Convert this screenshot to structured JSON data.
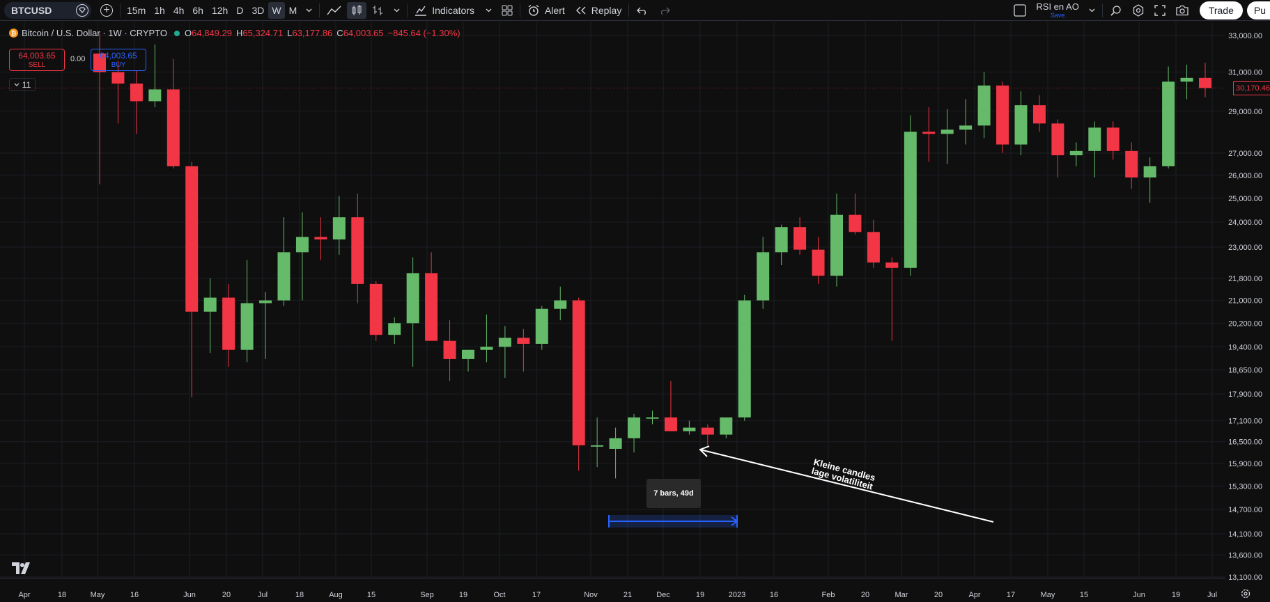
{
  "toolbar": {
    "symbol": "BTCUSD",
    "intervals": [
      "15m",
      "1h",
      "4h",
      "6h",
      "12h",
      "D",
      "3D",
      "W",
      "M"
    ],
    "active_interval": "W",
    "indicators_label": "Indicators",
    "alert_label": "Alert",
    "replay_label": "Replay",
    "layout_name": "RSI en AO",
    "layout_save": "Save",
    "trade_label": "Trade",
    "publish_label": "Pu"
  },
  "legend": {
    "title": "Bitcoin / U.S. Dollar · 1W · CRYPTO",
    "coin_glyph": "₿",
    "o_label": "O",
    "o_value": "64,849.29",
    "h_label": "H",
    "h_value": "65,324.71",
    "l_label": "L",
    "l_value": "63,177.86",
    "c_label": "C",
    "c_value": "64,003.65",
    "change": "−845.64 (−1.30%)"
  },
  "orders": {
    "sell_price": "64,003.65",
    "sell_label": "SELL",
    "spread": "0.00",
    "buy_price": "64,003.65",
    "buy_label": "BUY",
    "collapse_count": "11"
  },
  "last_price_badge": "30,170.46",
  "range_tooltip": "7 bars, 49d",
  "annotation": {
    "line1": "Kleine candles",
    "line2": "lage volatiliteit"
  },
  "colors": {
    "up": "#66bb6a",
    "down": "#f23645",
    "background": "#0f0f0f",
    "grid": "#1c1f26",
    "range": "#2962ff"
  },
  "chart_data": {
    "type": "candlestick",
    "y_axis_labels": [
      "33,000.00",
      "31,000.00",
      "29,000.00",
      "27,000.00",
      "26,000.00",
      "25,000.00",
      "24,000.00",
      "23,000.00",
      "21,800.00",
      "21,000.00",
      "20,200.00",
      "19,400.00",
      "18,650.00",
      "17,900.00",
      "17,100.00",
      "16,500.00",
      "15,900.00",
      "15,300.00",
      "14,700.00",
      "14,100.00",
      "13,600.00",
      "13,100.00"
    ],
    "x_axis_labels": [
      "Apr",
      "18",
      "May",
      "16",
      "Jun",
      "20",
      "Jul",
      "18",
      "Aug",
      "15",
      "Sep",
      "19",
      "Oct",
      "17",
      "Nov",
      "21",
      "Dec",
      "19",
      "2023",
      "16",
      "Feb",
      "20",
      "Mar",
      "20",
      "Apr",
      "17",
      "May",
      "15",
      "Jun",
      "19",
      "Jul"
    ],
    "candles": [
      {
        "o": 32000,
        "h": 33200,
        "l": 25600,
        "c": 31000
      },
      {
        "o": 31000,
        "h": 31600,
        "l": 28400,
        "c": 30400
      },
      {
        "o": 30400,
        "h": 31100,
        "l": 27900,
        "c": 29500
      },
      {
        "o": 29500,
        "h": 32500,
        "l": 29200,
        "c": 30100
      },
      {
        "o": 30100,
        "h": 31700,
        "l": 26300,
        "c": 26400
      },
      {
        "o": 26400,
        "h": 26600,
        "l": 17800,
        "c": 20600
      },
      {
        "o": 20600,
        "h": 21800,
        "l": 19200,
        "c": 21100
      },
      {
        "o": 21100,
        "h": 21600,
        "l": 18750,
        "c": 19300
      },
      {
        "o": 19300,
        "h": 22500,
        "l": 18900,
        "c": 20900
      },
      {
        "o": 20900,
        "h": 21300,
        "l": 19000,
        "c": 21000
      },
      {
        "o": 21000,
        "h": 24200,
        "l": 20800,
        "c": 22800
      },
      {
        "o": 22800,
        "h": 24400,
        "l": 21000,
        "c": 23400
      },
      {
        "o": 23400,
        "h": 24200,
        "l": 22500,
        "c": 23300
      },
      {
        "o": 23300,
        "h": 25100,
        "l": 22700,
        "c": 24200
      },
      {
        "o": 24200,
        "h": 25200,
        "l": 20900,
        "c": 21600
      },
      {
        "o": 21600,
        "h": 21700,
        "l": 19600,
        "c": 19800
      },
      {
        "o": 19800,
        "h": 20400,
        "l": 19500,
        "c": 20200
      },
      {
        "o": 20200,
        "h": 22600,
        "l": 18750,
        "c": 22000
      },
      {
        "o": 22000,
        "h": 22800,
        "l": 19700,
        "c": 19600
      },
      {
        "o": 19600,
        "h": 20300,
        "l": 18300,
        "c": 19000
      },
      {
        "o": 19000,
        "h": 19300,
        "l": 18600,
        "c": 19300
      },
      {
        "o": 19300,
        "h": 20500,
        "l": 18900,
        "c": 19400
      },
      {
        "o": 19400,
        "h": 20100,
        "l": 18400,
        "c": 19700
      },
      {
        "o": 19700,
        "h": 20000,
        "l": 18600,
        "c": 19500
      },
      {
        "o": 19500,
        "h": 20800,
        "l": 19300,
        "c": 20700
      },
      {
        "o": 20700,
        "h": 21500,
        "l": 20300,
        "c": 21000
      },
      {
        "o": 21000,
        "h": 21100,
        "l": 15700,
        "c": 16400
      },
      {
        "o": 16400,
        "h": 17200,
        "l": 15800,
        "c": 16400
      },
      {
        "o": 16300,
        "h": 16900,
        "l": 15500,
        "c": 16600
      },
      {
        "o": 16600,
        "h": 17300,
        "l": 16200,
        "c": 17200
      },
      {
        "o": 17200,
        "h": 17400,
        "l": 17000,
        "c": 17200
      },
      {
        "o": 17200,
        "h": 18300,
        "l": 16900,
        "c": 16800
      },
      {
        "o": 16800,
        "h": 17100,
        "l": 16700,
        "c": 16900
      },
      {
        "o": 16900,
        "h": 17000,
        "l": 16400,
        "c": 16700
      },
      {
        "o": 16700,
        "h": 16800,
        "l": 16600,
        "c": 17200
      },
      {
        "o": 17200,
        "h": 21200,
        "l": 17100,
        "c": 21000
      },
      {
        "o": 21000,
        "h": 23400,
        "l": 20700,
        "c": 22800
      },
      {
        "o": 22800,
        "h": 23900,
        "l": 22300,
        "c": 23800
      },
      {
        "o": 23800,
        "h": 24200,
        "l": 22700,
        "c": 22900
      },
      {
        "o": 22900,
        "h": 23400,
        "l": 21600,
        "c": 21900
      },
      {
        "o": 21900,
        "h": 25200,
        "l": 21500,
        "c": 24300
      },
      {
        "o": 24300,
        "h": 25200,
        "l": 23500,
        "c": 23600
      },
      {
        "o": 23600,
        "h": 24100,
        "l": 22200,
        "c": 22400
      },
      {
        "o": 22400,
        "h": 22600,
        "l": 19600,
        "c": 22200
      },
      {
        "o": 22200,
        "h": 28800,
        "l": 21900,
        "c": 28000
      },
      {
        "o": 28000,
        "h": 29200,
        "l": 26600,
        "c": 27900
      },
      {
        "o": 27900,
        "h": 29100,
        "l": 26500,
        "c": 28100
      },
      {
        "o": 28100,
        "h": 29600,
        "l": 27400,
        "c": 28300
      },
      {
        "o": 28300,
        "h": 31000,
        "l": 27700,
        "c": 30300
      },
      {
        "o": 30300,
        "h": 30500,
        "l": 27000,
        "c": 27400
      },
      {
        "o": 27400,
        "h": 30000,
        "l": 26900,
        "c": 29300
      },
      {
        "o": 29300,
        "h": 29800,
        "l": 28000,
        "c": 28400
      },
      {
        "o": 28400,
        "h": 28600,
        "l": 25900,
        "c": 26900
      },
      {
        "o": 26900,
        "h": 27500,
        "l": 26400,
        "c": 27100
      },
      {
        "o": 27100,
        "h": 28500,
        "l": 25900,
        "c": 28200
      },
      {
        "o": 28200,
        "h": 28500,
        "l": 26700,
        "c": 27100
      },
      {
        "o": 27100,
        "h": 27500,
        "l": 25400,
        "c": 25900
      },
      {
        "o": 25900,
        "h": 26800,
        "l": 24800,
        "c": 26400
      },
      {
        "o": 26400,
        "h": 31300,
        "l": 26300,
        "c": 30500
      },
      {
        "o": 30500,
        "h": 31400,
        "l": 29600,
        "c": 30700
      },
      {
        "o": 30700,
        "h": 31500,
        "l": 29700,
        "c": 30170
      }
    ]
  }
}
